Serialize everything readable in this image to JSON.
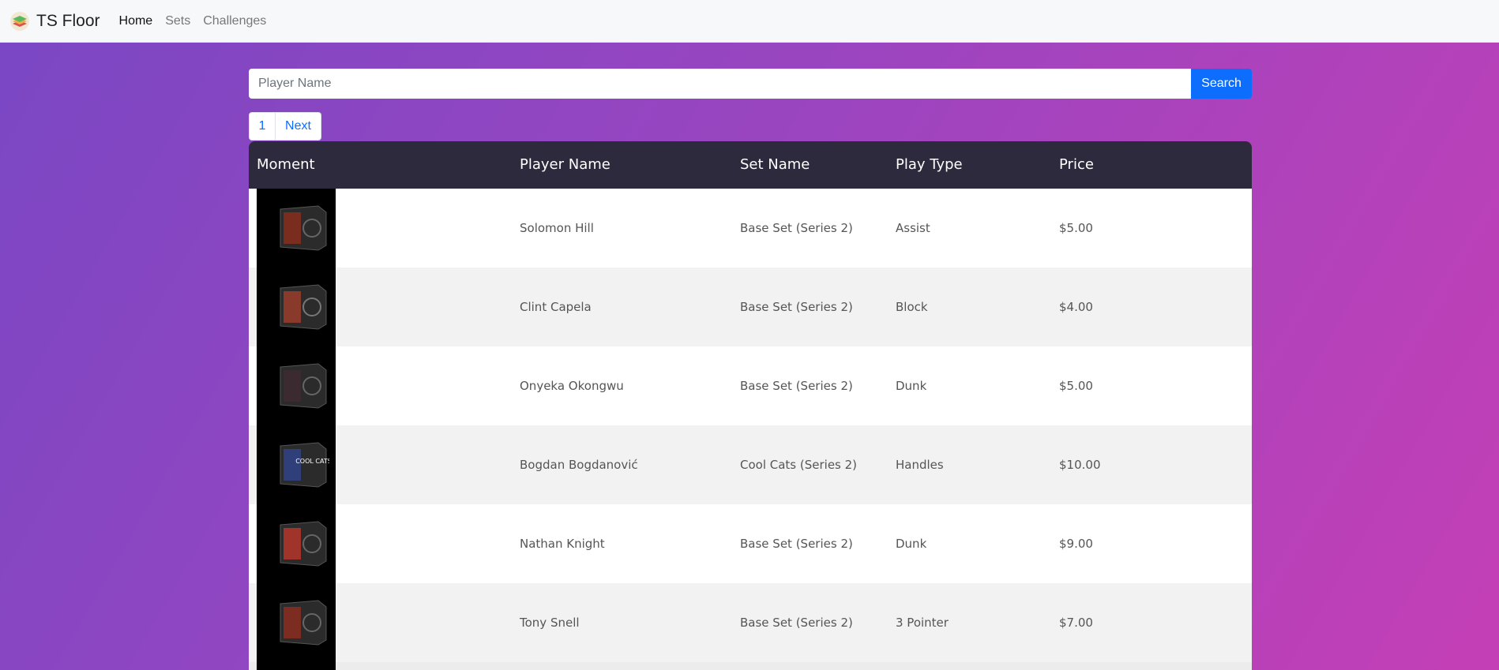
{
  "nav": {
    "brand": "TS Floor",
    "links": [
      {
        "label": "Home",
        "active": true
      },
      {
        "label": "Sets",
        "active": false
      },
      {
        "label": "Challenges",
        "active": false
      }
    ]
  },
  "search": {
    "placeholder": "Player Name",
    "value": "",
    "button_label": "Search"
  },
  "pagination": {
    "current": "1",
    "next_label": "Next"
  },
  "table": {
    "headers": [
      "Moment",
      "Player Name",
      "Set Name",
      "Play Type",
      "Price"
    ],
    "rows": [
      {
        "player": "Solomon Hill",
        "set": "Base Set (Series 2)",
        "play_type": "Assist",
        "price": "$5.00",
        "thumb_icon": "moment-card-icon"
      },
      {
        "player": "Clint Capela",
        "set": "Base Set (Series 2)",
        "play_type": "Block",
        "price": "$4.00",
        "thumb_icon": "moment-card-icon"
      },
      {
        "player": "Onyeka Okongwu",
        "set": "Base Set (Series 2)",
        "play_type": "Dunk",
        "price": "$5.00",
        "thumb_icon": "moment-card-icon"
      },
      {
        "player": "Bogdan Bogdanović",
        "set": "Cool Cats (Series 2)",
        "play_type": "Handles",
        "price": "$10.00",
        "thumb_icon": "moment-card-icon",
        "thumb_text": "COOL CATS"
      },
      {
        "player": "Nathan Knight",
        "set": "Base Set (Series 2)",
        "play_type": "Dunk",
        "price": "$9.00",
        "thumb_icon": "moment-card-icon"
      },
      {
        "player": "Tony Snell",
        "set": "Base Set (Series 2)",
        "play_type": "3 Pointer",
        "price": "$7.00",
        "thumb_icon": "moment-card-icon"
      }
    ]
  },
  "colors": {
    "accent": "#0d6efd",
    "table_header_bg": "#2e2a3d",
    "background_gradient_start": "#7a47c4",
    "background_gradient_end": "#c43fb6"
  }
}
